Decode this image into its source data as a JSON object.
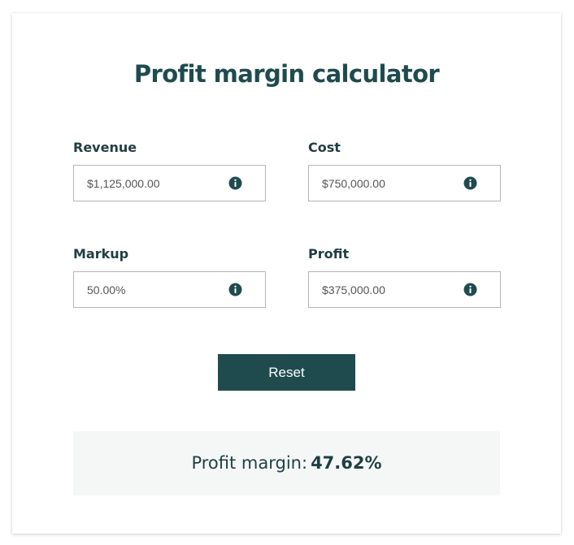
{
  "title": "Profit margin calculator",
  "fields": {
    "revenue": {
      "label": "Revenue",
      "value": "$1,125,000.00"
    },
    "cost": {
      "label": "Cost",
      "value": "$750,000.00"
    },
    "markup": {
      "label": "Markup",
      "value": "50.00%"
    },
    "profit": {
      "label": "Profit",
      "value": "$375,000.00"
    }
  },
  "reset_label": "Reset",
  "result": {
    "label": "Profit margin:",
    "value": "47.62%"
  },
  "colors": {
    "accent": "#1f4b4f",
    "text": "#1f3f42",
    "panel": "#f5f7f7",
    "border": "#b6b6b6"
  },
  "icons": {
    "info": "info-icon"
  }
}
